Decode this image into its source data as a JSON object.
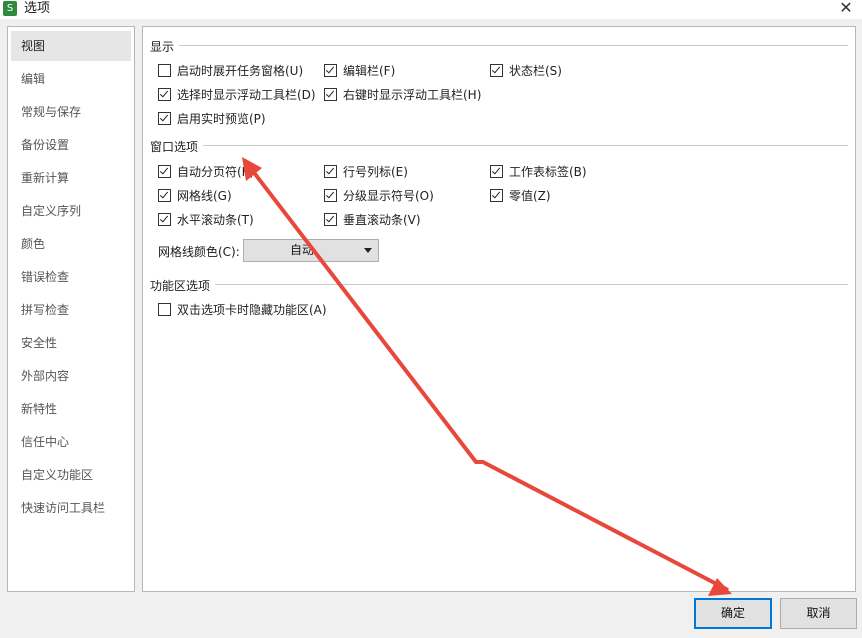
{
  "window": {
    "title": "选项",
    "icon_letter": "S"
  },
  "sidebar": {
    "items": [
      {
        "label": "视图"
      },
      {
        "label": "编辑"
      },
      {
        "label": "常规与保存"
      },
      {
        "label": "备份设置"
      },
      {
        "label": "重新计算"
      },
      {
        "label": "自定义序列"
      },
      {
        "label": "颜色"
      },
      {
        "label": "错误检查"
      },
      {
        "label": "拼写检查"
      },
      {
        "label": "安全性"
      },
      {
        "label": "外部内容"
      },
      {
        "label": "新特性"
      },
      {
        "label": "信任中心"
      },
      {
        "label": "自定义功能区"
      },
      {
        "label": "快速访问工具栏"
      }
    ],
    "active_index": 0
  },
  "display": {
    "title": "显示",
    "options": [
      {
        "label": "启动时展开任务窗格(U)",
        "checked": false
      },
      {
        "label": "编辑栏(F)",
        "checked": true
      },
      {
        "label": "状态栏(S)",
        "checked": true
      },
      {
        "label": "选择时显示浮动工具栏(D)",
        "checked": true
      },
      {
        "label": "右键时显示浮动工具栏(H)",
        "checked": true
      },
      {
        "label": "启用实时预览(P)",
        "checked": true
      }
    ]
  },
  "window_options": {
    "title": "窗口选项",
    "options": [
      {
        "label": "自动分页符(K)",
        "checked": true
      },
      {
        "label": "行号列标(E)",
        "checked": true
      },
      {
        "label": "工作表标签(B)",
        "checked": true
      },
      {
        "label": "网格线(G)",
        "checked": true
      },
      {
        "label": "分级显示符号(O)",
        "checked": true
      },
      {
        "label": "零值(Z)",
        "checked": true
      },
      {
        "label": "水平滚动条(T)",
        "checked": true
      },
      {
        "label": "垂直滚动条(V)",
        "checked": true
      }
    ],
    "gridline_color_label": "网格线颜色(C):",
    "gridline_color_value": "自动"
  },
  "ribbon": {
    "title": "功能区选项",
    "options": [
      {
        "label": "双击选项卡时隐藏功能区(A)",
        "checked": false
      }
    ]
  },
  "buttons": {
    "ok": "确定",
    "cancel": "取消"
  },
  "annotation": {
    "arrow_color": "#e8483b"
  }
}
